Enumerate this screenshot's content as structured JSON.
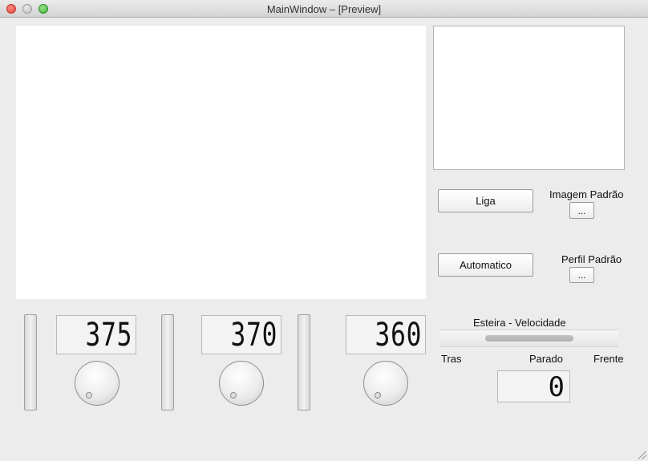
{
  "window": {
    "title": "MainWindow – [Preview]"
  },
  "controls": {
    "liga_label": "Liga",
    "automatico_label": "Automatico",
    "imagem_padrao_label": "Imagem Padrão",
    "imagem_padrao_button": "...",
    "perfil_padrao_label": "Perfil Padrão",
    "perfil_padrao_button": "..."
  },
  "channels": [
    {
      "lcd_value": "375"
    },
    {
      "lcd_value": "370"
    },
    {
      "lcd_value": "360"
    }
  ],
  "esteira": {
    "title": "Esteira - Velocidade",
    "label_left": "Tras",
    "label_center": "Parado",
    "label_right": "Frente",
    "lcd_value": "0"
  }
}
